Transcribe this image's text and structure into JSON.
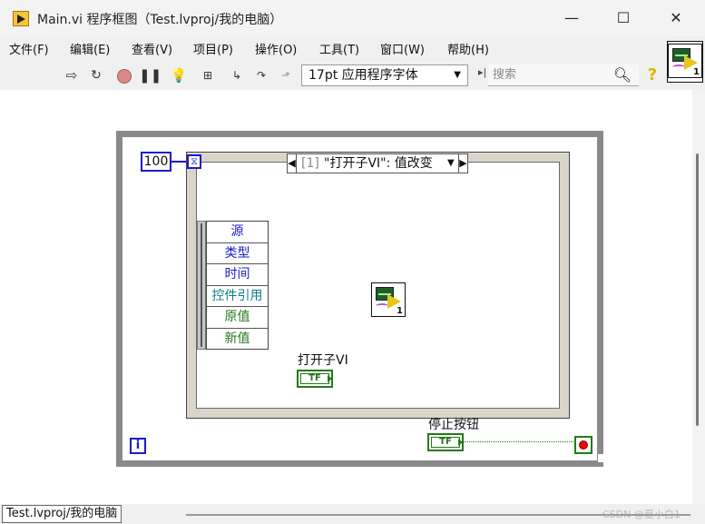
{
  "window": {
    "title": "Main.vi 程序框图（Test.lvproj/我的电脑）",
    "controls": {
      "minimize": "—",
      "maximize": "☐",
      "close": "✕"
    }
  },
  "menu": {
    "items": [
      "文件(F)",
      "编辑(E)",
      "查看(V)",
      "项目(P)",
      "操作(O)",
      "工具(T)",
      "窗口(W)",
      "帮助(H)"
    ]
  },
  "toolbar": {
    "font_setting": "17pt 应用程序字体",
    "search_placeholder": "搜索",
    "help_glyph": "?"
  },
  "vi_icon": {
    "number": "1"
  },
  "diagram": {
    "timeout_constant": "100",
    "timeout_terminal": "⧖",
    "iteration_terminal": "i",
    "event_case": {
      "index": "[1]",
      "label": "\"打开子VI\": 值改变"
    },
    "event_data_node": [
      {
        "label": "源",
        "color": "blue"
      },
      {
        "label": "类型",
        "color": "blue"
      },
      {
        "label": "时间",
        "color": "blue"
      },
      {
        "label": "控件引用",
        "color": "teal"
      },
      {
        "label": "原值",
        "color": "green"
      },
      {
        "label": "新值",
        "color": "green"
      }
    ],
    "subvi": {
      "number": "1"
    },
    "open_subvi": {
      "label": "打开子VI",
      "terminal_text": "TF"
    },
    "stop_button": {
      "label": "停止按钮",
      "terminal_text": "TF"
    }
  },
  "status": {
    "path": "Test.lvproj/我的电脑",
    "watermark": "CSDN @夏小白1"
  },
  "colors": {
    "int_wire": "#1b1bcf",
    "bool": "#257a1a",
    "ref": "#137d85",
    "stop": "#e20b0b",
    "while_loop": "#8a8a8a"
  }
}
